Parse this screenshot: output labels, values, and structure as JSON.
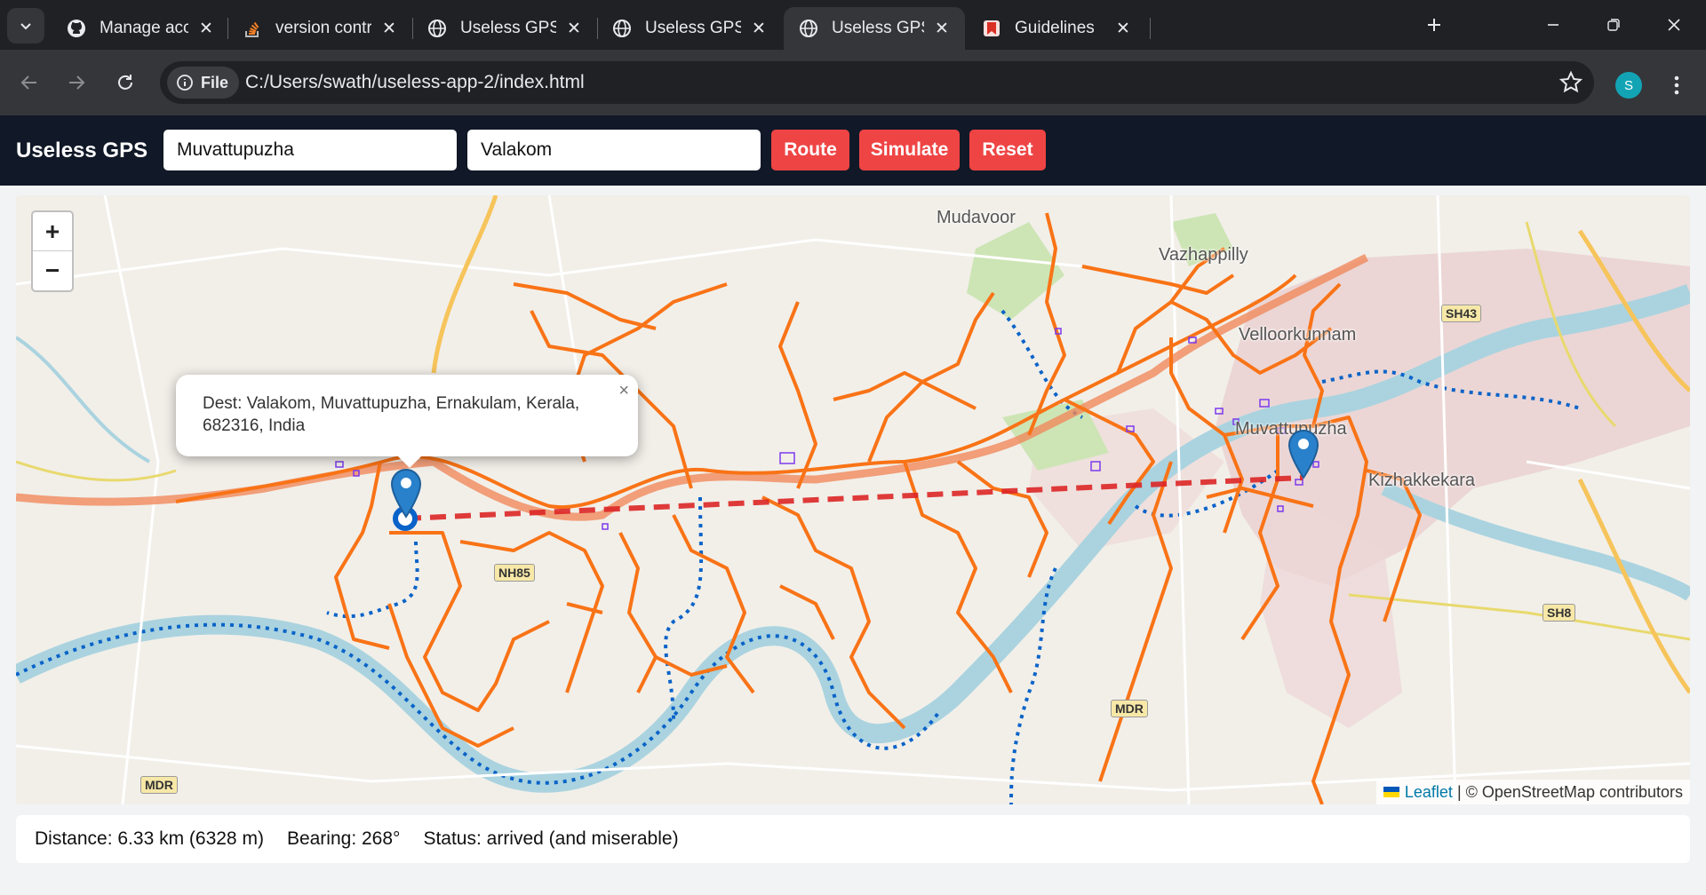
{
  "browser": {
    "tabs": [
      {
        "title": "Manage access",
        "favicon": "github-icon"
      },
      {
        "title": "version control - H",
        "favicon": "stackoverflow-icon"
      },
      {
        "title": "Useless GPS — Ful",
        "favicon": "globe-icon"
      },
      {
        "title": "Useless GPS — An",
        "favicon": "globe-icon"
      },
      {
        "title": "Useless GPS — Wa",
        "favicon": "globe-icon",
        "active": true
      },
      {
        "title": "Guidelines",
        "favicon": "guidelines-icon"
      }
    ],
    "site_chip": "File",
    "url": "C:/Users/swath/useless-app-2/index.html",
    "profile_initial": "S"
  },
  "app": {
    "title": "Useless GPS",
    "origin_value": "Muvattupuzha",
    "destination_value": "Valakom",
    "buttons": {
      "route": "Route",
      "simulate": "Simulate",
      "reset": "Reset"
    },
    "accent_color": "#ef4444"
  },
  "map": {
    "zoom_in": "+",
    "zoom_out": "−",
    "popup_text": "Dest: Valakom, Muvattupuzha, Ernakulam, Kerala, 682316, India",
    "popup_close": "×",
    "attribution_link": "Leaflet",
    "attribution_rest": " | © OpenStreetMap contributors",
    "place_labels": {
      "mudavoor": "Mudavoor",
      "vazhappilly": "Vazhappilly",
      "velloorkunnam": "Velloorkunnam",
      "muvattupuzha": "Muvattupuzha",
      "kizhakkekara": "Kizhakkekara"
    },
    "road_badges": {
      "nh85": "NH85",
      "sh43": "SH43",
      "sh8": "SH8",
      "mdr_left": "MDR",
      "mdr_right": "MDR"
    }
  },
  "status": {
    "distance": "Distance: 6.33 km (6328 m)",
    "bearing": "Bearing: 268°",
    "status": "Status: arrived (and miserable)"
  }
}
